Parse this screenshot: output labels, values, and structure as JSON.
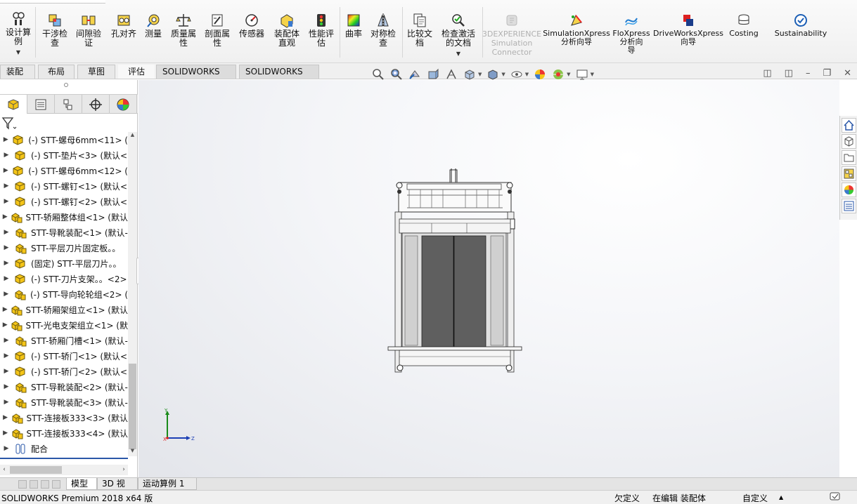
{
  "ribbon": {
    "buttons": [
      {
        "id": "design-study",
        "label": "设计算\n例",
        "icon": "design-study-icon"
      },
      {
        "id": "interference",
        "label": "干涉检\n查",
        "icon": "interference-icon"
      },
      {
        "id": "clearance",
        "label": "间隙验\n证",
        "icon": "clearance-icon"
      },
      {
        "id": "hole-align",
        "label": "孔对齐",
        "icon": "hole-align-icon"
      },
      {
        "id": "measure",
        "label": "测量",
        "icon": "measure-icon"
      },
      {
        "id": "mass-props",
        "label": "质量属\n性",
        "icon": "mass-properties-icon"
      },
      {
        "id": "section-props",
        "label": "剖面属\n性",
        "icon": "section-properties-icon"
      },
      {
        "id": "sensor",
        "label": "传感器",
        "icon": "sensor-icon"
      },
      {
        "id": "asm-visual",
        "label": "装配体\n直观",
        "icon": "assembly-visualization-icon"
      },
      {
        "id": "perf-eval",
        "label": "性能评\n估",
        "icon": "performance-evaluation-icon"
      },
      {
        "id": "curvature",
        "label": "曲率",
        "icon": "curvature-icon"
      },
      {
        "id": "symmetry",
        "label": "对称检\n查",
        "icon": "symmetry-check-icon"
      },
      {
        "id": "compare",
        "label": "比较文\n档",
        "icon": "compare-documents-icon"
      },
      {
        "id": "check-active",
        "label": "检查激活\n的文档",
        "icon": "check-active-document-icon"
      },
      {
        "id": "3dx",
        "label": "3DEXPERIENCE\nSimulation\nConnector",
        "icon": "3dexperience-icon"
      },
      {
        "id": "simxpress",
        "label": "SimulationXpress\n分析向导",
        "icon": "simulationxpress-icon"
      },
      {
        "id": "floxpress",
        "label": "FloXpress\n分析向\n导",
        "icon": "floxpress-icon"
      },
      {
        "id": "driveworks",
        "label": "DriveWorksXpress\n向导",
        "icon": "driveworksxpress-icon"
      },
      {
        "id": "costing",
        "label": "Costing",
        "icon": "costing-icon"
      },
      {
        "id": "sustain",
        "label": "Sustainability",
        "icon": "sustainability-icon"
      }
    ]
  },
  "tabs": [
    "装配体",
    "布局",
    "草图",
    "评估",
    "SOLIDWORKS 插件",
    "SOLIDWORKS MBD"
  ],
  "tree": {
    "items": [
      {
        "label": "(-) STT-螺母6mm<11> (",
        "icon": "part-icon"
      },
      {
        "label": "(-) STT-垫片<3> (默认<",
        "icon": "part-icon"
      },
      {
        "label": "(-) STT-螺母6mm<12> (",
        "icon": "part-icon"
      },
      {
        "label": "(-) STT-螺钉<1> (默认<",
        "icon": "part-icon"
      },
      {
        "label": "(-) STT-螺钉<2> (默认<",
        "icon": "part-icon"
      },
      {
        "label": "STT-轿厢整体组<1> (默认",
        "icon": "subassembly-icon"
      },
      {
        "label": "STT-导靴装配<1> (默认-",
        "icon": "subassembly-icon"
      },
      {
        "label": "STT-平层刀片固定板。。",
        "icon": "subassembly-icon"
      },
      {
        "label": "(固定) STT-平层刀片。。",
        "icon": "part-icon"
      },
      {
        "label": "(-) STT-刀片支架。。<2>",
        "icon": "part-icon"
      },
      {
        "label": "(-) STT-导向轮轮组<2> (",
        "icon": "subassembly-icon"
      },
      {
        "label": "STT-轿厢架组立<1> (默认",
        "icon": "subassembly-icon"
      },
      {
        "label": "STT-光电支架组立<1> (默",
        "icon": "subassembly-icon"
      },
      {
        "label": "STT-轿厢门槽<1> (默认-",
        "icon": "subassembly-icon"
      },
      {
        "label": "(-) STT-轿门<1> (默认<",
        "icon": "part-icon"
      },
      {
        "label": "(-) STT-轿门<2> (默认<",
        "icon": "part-icon"
      },
      {
        "label": "STT-导靴装配<2> (默认-",
        "icon": "subassembly-icon"
      },
      {
        "label": "STT-导靴装配<3> (默认-",
        "icon": "subassembly-icon"
      },
      {
        "label": "STT-连接板333<3> (默认",
        "icon": "subassembly-icon"
      },
      {
        "label": "STT-连接板333<4> (默认",
        "icon": "subassembly-icon"
      },
      {
        "label": "配合",
        "icon": "mates-icon"
      }
    ]
  },
  "triad": {
    "x": "X",
    "y": "Y",
    "z": "Z"
  },
  "bottom_tabs": [
    "模型",
    "3D 视图",
    "运动算例 1"
  ],
  "status": {
    "app": "SOLIDWORKS Premium 2018 x64 版",
    "defined": "欠定义",
    "editing": "在编辑 装配体",
    "units": "自定义",
    "units_caret": "▲"
  },
  "colors": {
    "accent": "#2a57a8",
    "door": "#5e5e5e",
    "frame": "#d9d9d9"
  }
}
